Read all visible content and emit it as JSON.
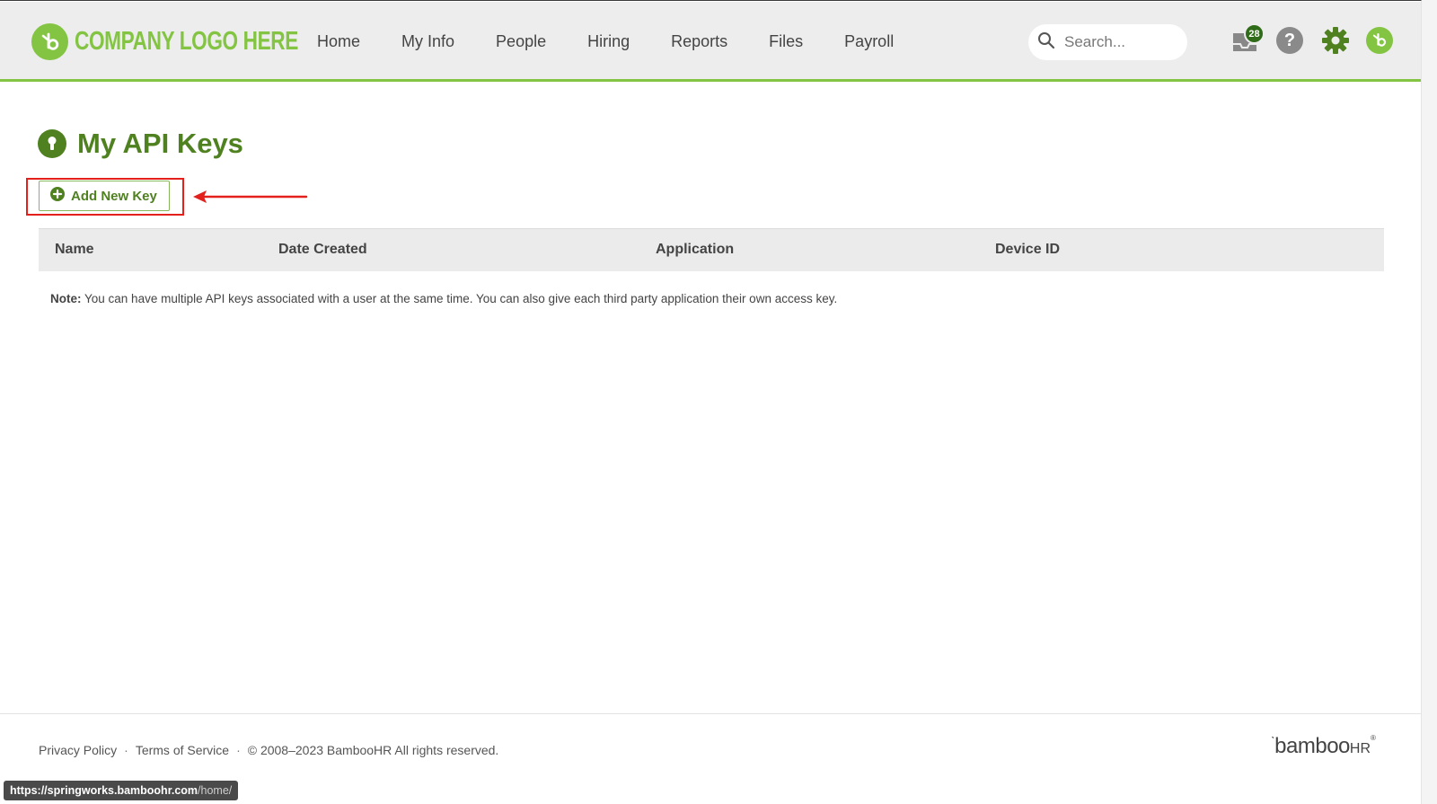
{
  "header": {
    "logo_text": "COMPANY LOGO HERE",
    "nav": [
      {
        "label": "Home"
      },
      {
        "label": "My Info"
      },
      {
        "label": "People"
      },
      {
        "label": "Hiring"
      },
      {
        "label": "Reports"
      },
      {
        "label": "Files"
      },
      {
        "label": "Payroll"
      }
    ],
    "search": {
      "placeholder": "Search...",
      "value": ""
    },
    "inbox_count": "28",
    "icons": [
      "inbox-icon",
      "help-icon",
      "gear-icon",
      "avatar"
    ]
  },
  "page": {
    "title": "My API Keys",
    "title_icon": "keyhole-icon",
    "add_button_label": "Add New Key"
  },
  "table": {
    "columns": [
      "Name",
      "Date Created",
      "Application",
      "Device ID"
    ],
    "rows": []
  },
  "note": {
    "label": "Note:",
    "text": " You can have multiple API keys associated with a user at the same time. You can also give each third party application their own access key."
  },
  "footer": {
    "privacy": "Privacy Policy",
    "terms": "Terms of Service",
    "copyright": "© 2008–2023 BambooHR All rights reserved.",
    "brand": "bamboo",
    "brand_suffix": "HR",
    "separator": "·"
  },
  "status_bar": {
    "host": "https://springworks.bamboohr.com",
    "path": "/home/"
  },
  "colors": {
    "accent_green": "#84c443",
    "dark_green": "#4f8121",
    "annotation_red": "#e4201d"
  }
}
